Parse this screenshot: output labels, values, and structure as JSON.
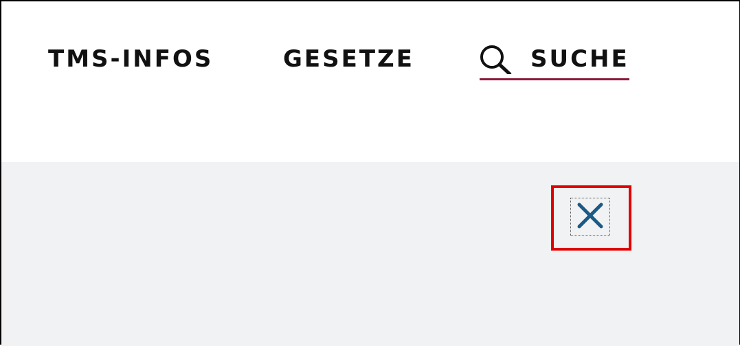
{
  "nav": {
    "items": [
      {
        "label": "TMS-INFOS"
      },
      {
        "label": "GESETZE"
      },
      {
        "label": "SUCHE",
        "icon": "search-icon",
        "active": true
      }
    ],
    "active_underline_color": "#8b1a3a"
  },
  "overlay": {
    "background": "#f1f2f4",
    "close_button": {
      "icon": "close-icon",
      "color": "#1b5a86",
      "highlighted": true,
      "highlight_color": "#e00000"
    }
  }
}
